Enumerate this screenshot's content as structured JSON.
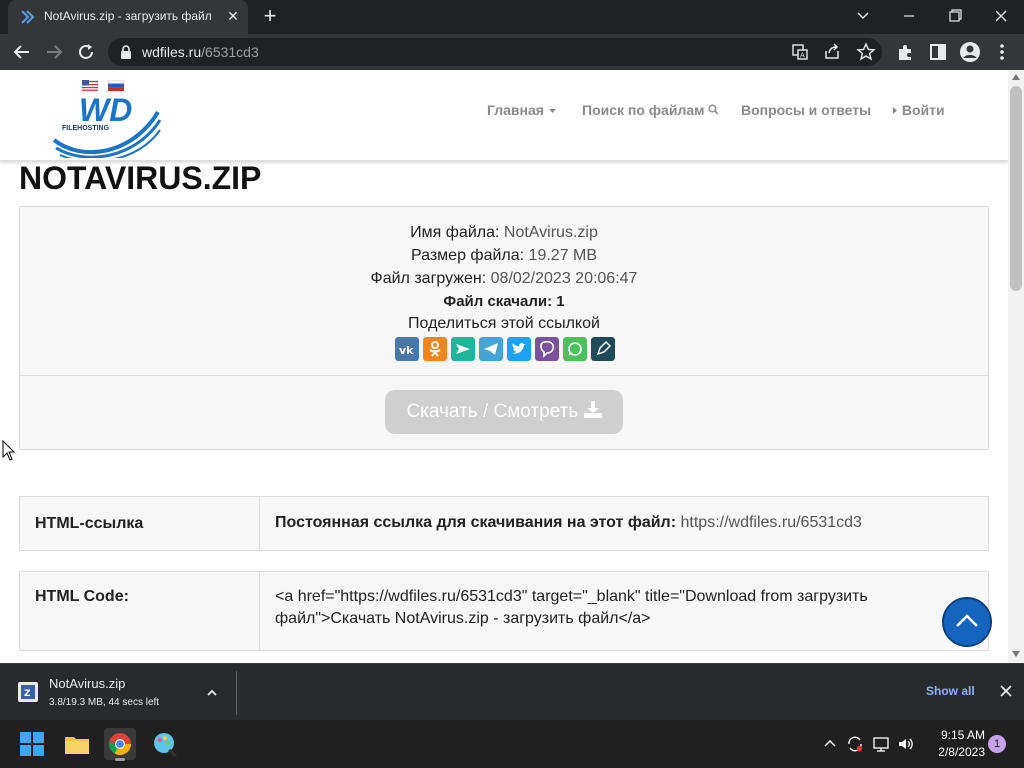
{
  "browser": {
    "tab_title": "NotAvirus.zip - загрузить файл",
    "tab_close": "✕",
    "new_tab": "+",
    "url_host": "wdfiles.ru",
    "url_path": "/6531cd3"
  },
  "site": {
    "logo_text": "WD",
    "logo_sub": "FILEHOSTING",
    "nav": {
      "home": "Главная",
      "search": "Поиск по файлам",
      "faq": "Вопросы и ответы",
      "login": "Войти"
    }
  },
  "file": {
    "heading": "NOTAVIRUS.ZIP",
    "name_label": "Имя файла:",
    "name_value": "NotAvirus.zip",
    "size_label": "Размер файла:",
    "size_value": "19.27 MB",
    "uploaded_label": "Файл загружен:",
    "uploaded_value": "08/02/2023 20:06:47",
    "downloads_label": "Файл скачали:",
    "downloads_value": "1",
    "share_label": "Поделиться этой ссылкой",
    "share_icons": [
      "vk-icon",
      "odnoklassniki-icon",
      "mail-icon",
      "telegram-icon",
      "twitter-icon",
      "viber-icon",
      "whatsapp-icon",
      "livejournal-icon"
    ],
    "download_button": "Скачать / Смотреть"
  },
  "links": {
    "html_link_label": "HTML-ссылка",
    "html_link_desc": "Постоянная ссылка для скачивания на этот файл:",
    "html_link_url": "https://wdfiles.ru/6531cd3",
    "html_code_label": "HTML Code:",
    "html_code_value": "<a href=\"https://wdfiles.ru/6531cd3\" target=\"_blank\" title=\"Download from загрузить файл\">Скачать NotAvirus.zip - загрузить файл</a>"
  },
  "download_shelf": {
    "filename": "NotAvirus.zip",
    "progress": "3.8/19.3 MB, 44 secs left",
    "show_all": "Show all"
  },
  "taskbar": {
    "time": "9:15 AM",
    "date": "2/8/2023",
    "notifications": "1"
  },
  "colors": {
    "accent": "#1565c0",
    "download_button": "#cfcfcf",
    "chrome_dark": "#202124"
  }
}
